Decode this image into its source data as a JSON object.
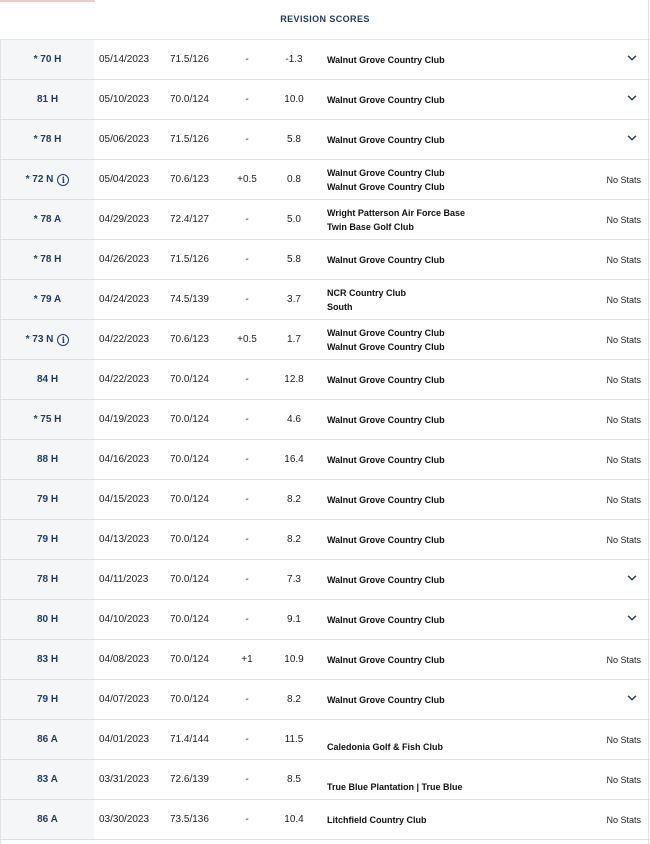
{
  "header": {
    "title": "REVISION SCORES"
  },
  "colors": {
    "accent": "#1f3c64",
    "score_bg": "#f5f6f8",
    "border": "#dedede",
    "tab_accent": "#f3c9cc"
  },
  "icons": {
    "info": "info-circle-icon",
    "expand": "chevron-down-icon"
  },
  "rows": [
    {
      "score": "* 70 H",
      "info": false,
      "date": "05/14/2023",
      "rating": "71.5/126",
      "adj": "-",
      "diff": "-1.3",
      "course": [
        "Walnut Grove Country Club"
      ],
      "stats": "",
      "expand": true
    },
    {
      "score": "81 H",
      "info": false,
      "date": "05/10/2023",
      "rating": "70.0/124",
      "adj": "-",
      "diff": "10.0",
      "course": [
        "Walnut Grove Country Club"
      ],
      "stats": "",
      "expand": true
    },
    {
      "score": "* 78 H",
      "info": false,
      "date": "05/06/2023",
      "rating": "71.5/126",
      "adj": "-",
      "diff": "5.8",
      "course": [
        "Walnut Grove Country Club"
      ],
      "stats": "",
      "expand": true
    },
    {
      "score": "* 72 N",
      "info": true,
      "date": "05/04/2023",
      "rating": "70.6/123",
      "adj": "+0.5",
      "diff": "0.8",
      "course": [
        "Walnut Grove Country Club",
        "Walnut Grove Country Club"
      ],
      "stats": "No Stats",
      "expand": false
    },
    {
      "score": "* 78 A",
      "info": false,
      "date": "04/29/2023",
      "rating": "72.4/127",
      "adj": "-",
      "diff": "5.0",
      "course": [
        "Wright Patterson Air Force Base",
        "Twin Base Golf Club"
      ],
      "stats": "No Stats",
      "expand": false
    },
    {
      "score": "* 78 H",
      "info": false,
      "date": "04/26/2023",
      "rating": "71.5/126",
      "adj": "-",
      "diff": "5.8",
      "course": [
        "Walnut Grove Country Club"
      ],
      "stats": "No Stats",
      "expand": false
    },
    {
      "score": "* 79 A",
      "info": false,
      "date": "04/24/2023",
      "rating": "74.5/139",
      "adj": "-",
      "diff": "3.7",
      "course": [
        "NCR Country Club",
        "South"
      ],
      "stats": "No Stats",
      "expand": false
    },
    {
      "score": "* 73 N",
      "info": true,
      "date": "04/22/2023",
      "rating": "70.6/123",
      "adj": "+0.5",
      "diff": "1.7",
      "course": [
        "Walnut Grove Country Club",
        "Walnut Grove Country Club"
      ],
      "stats": "No Stats",
      "expand": false
    },
    {
      "score": "84 H",
      "info": false,
      "date": "04/22/2023",
      "rating": "70.0/124",
      "adj": "-",
      "diff": "12.8",
      "course": [
        "Walnut Grove Country Club"
      ],
      "stats": "No Stats",
      "expand": false
    },
    {
      "score": "* 75 H",
      "info": false,
      "date": "04/19/2023",
      "rating": "70.0/124",
      "adj": "-",
      "diff": "4.6",
      "course": [
        "Walnut Grove Country Club"
      ],
      "stats": "No Stats",
      "expand": false
    },
    {
      "score": "88 H",
      "info": false,
      "date": "04/16/2023",
      "rating": "70.0/124",
      "adj": "-",
      "diff": "16.4",
      "course": [
        "Walnut Grove Country Club"
      ],
      "stats": "No Stats",
      "expand": false
    },
    {
      "score": "79 H",
      "info": false,
      "date": "04/15/2023",
      "rating": "70.0/124",
      "adj": "-",
      "diff": "8.2",
      "course": [
        "Walnut Grove Country Club"
      ],
      "stats": "No Stats",
      "expand": false
    },
    {
      "score": "79 H",
      "info": false,
      "date": "04/13/2023",
      "rating": "70.0/124",
      "adj": "-",
      "diff": "8.2",
      "course": [
        "Walnut Grove Country Club"
      ],
      "stats": "No Stats",
      "expand": false
    },
    {
      "score": "78 H",
      "info": false,
      "date": "04/11/2023",
      "rating": "70.0/124",
      "adj": "-",
      "diff": "7.3",
      "course": [
        "Walnut Grove Country Club"
      ],
      "stats": "",
      "expand": true
    },
    {
      "score": "80 H",
      "info": false,
      "date": "04/10/2023",
      "rating": "70.0/124",
      "adj": "-",
      "diff": "9.1",
      "course": [
        "Walnut Grove Country Club"
      ],
      "stats": "",
      "expand": true
    },
    {
      "score": "83 H",
      "info": false,
      "date": "04/08/2023",
      "rating": "70.0/124",
      "adj": "+1",
      "diff": "10.9",
      "course": [
        "Walnut Grove Country Club"
      ],
      "stats": "No Stats",
      "expand": false
    },
    {
      "score": "79 H",
      "info": false,
      "date": "04/07/2023",
      "rating": "70.0/124",
      "adj": "-",
      "diff": "8.2",
      "course": [
        "Walnut Grove Country Club"
      ],
      "stats": "",
      "expand": true
    },
    {
      "score": "86 A",
      "info": false,
      "date": "04/01/2023",
      "rating": "71.4/144",
      "adj": "-",
      "diff": "11.5",
      "course": [
        "Caledonia Golf & Fish Club"
      ],
      "course_low": true,
      "stats": "No Stats",
      "expand": false
    },
    {
      "score": "83 A",
      "info": false,
      "date": "03/31/2023",
      "rating": "72.6/139",
      "adj": "-",
      "diff": "8.5",
      "course": [
        "True Blue Plantation | True Blue"
      ],
      "course_low": true,
      "stats": "No Stats",
      "expand": false
    },
    {
      "score": "86 A",
      "info": false,
      "date": "03/30/2023",
      "rating": "73.5/136",
      "adj": "-",
      "diff": "10.4",
      "course": [
        "Litchfield Country Club"
      ],
      "stats": "No Stats",
      "expand": false
    }
  ]
}
